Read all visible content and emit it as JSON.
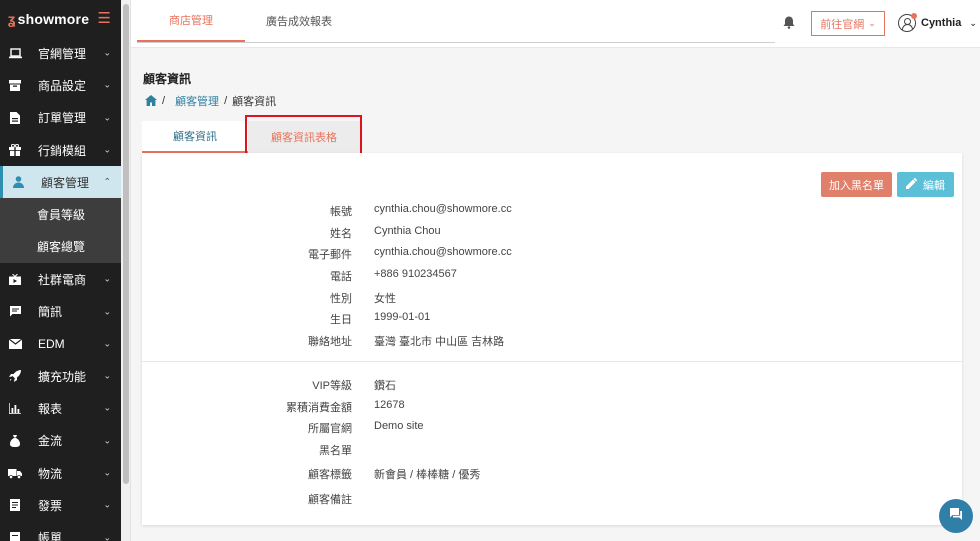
{
  "brand": {
    "logo_mark": "ʓ",
    "name": "showmore",
    "menu_icon": "hamburger-icon",
    "accent": "#e8735c"
  },
  "sidebar": {
    "items": [
      {
        "label": "官網管理",
        "icon": "laptop-icon"
      },
      {
        "label": "商品設定",
        "icon": "box-icon"
      },
      {
        "label": "訂單管理",
        "icon": "document-icon"
      },
      {
        "label": "行銷模組",
        "icon": "gift-icon"
      },
      {
        "label": "顧客管理",
        "icon": "person-icon",
        "active": true
      },
      {
        "label": "社群電商",
        "icon": "tv-icon"
      },
      {
        "label": "簡訊",
        "icon": "message-icon"
      },
      {
        "label": "EDM",
        "icon": "envelope-icon"
      },
      {
        "label": "擴充功能",
        "icon": "rocket-icon"
      },
      {
        "label": "報表",
        "icon": "bar-chart-icon"
      },
      {
        "label": "金流",
        "icon": "money-bag-icon"
      },
      {
        "label": "物流",
        "icon": "truck-icon"
      },
      {
        "label": "發票",
        "icon": "invoice-icon"
      },
      {
        "label": "帳單",
        "icon": "bill-icon"
      }
    ],
    "sub_items": [
      {
        "label": "會員等級"
      },
      {
        "label": "顧客總覽"
      }
    ]
  },
  "topbar": {
    "tabs": [
      {
        "label": "商店管理"
      },
      {
        "label": "廣告成效報表"
      }
    ],
    "site_button": "前往官網",
    "user_name": "Cynthia"
  },
  "page": {
    "title": "顧客資訊",
    "breadcrumb": {
      "link": "顧客管理",
      "current": "顧客資訊"
    },
    "tabs": [
      {
        "label": "顧客資訊"
      },
      {
        "label": "顧客資訊表格"
      }
    ]
  },
  "actions": {
    "blacklist": "加入黑名單",
    "edit": "編輯"
  },
  "profile": [
    {
      "label": "帳號",
      "value": "cynthia.chou@showmore.cc"
    },
    {
      "label": "姓名",
      "value": "Cynthia Chou"
    },
    {
      "label": "電子郵件",
      "value": "cynthia.chou@showmore.cc"
    },
    {
      "label": "電話",
      "value": "+886 910234567"
    },
    {
      "label": "性別",
      "value": "女性"
    },
    {
      "label": "生日",
      "value": "1999-01-01"
    },
    {
      "label": "聯絡地址",
      "value": "臺灣 臺北市 中山區 吉林路"
    }
  ],
  "membership": [
    {
      "label": "VIP等級",
      "value": "鑽石"
    },
    {
      "label": "累積消費金額",
      "value": "12678"
    },
    {
      "label": "所屬官網",
      "value": "Demo site"
    },
    {
      "label": "黑名單",
      "value": ""
    },
    {
      "label": "顧客標籤",
      "value": "新會員 / 棒棒糖 / 優秀"
    },
    {
      "label": "顧客備註",
      "value": ""
    }
  ],
  "colors": {
    "accent": "#e8735c",
    "link": "#2f7fa0",
    "edit": "#5bbfd8",
    "highlight": "#e0121d"
  }
}
